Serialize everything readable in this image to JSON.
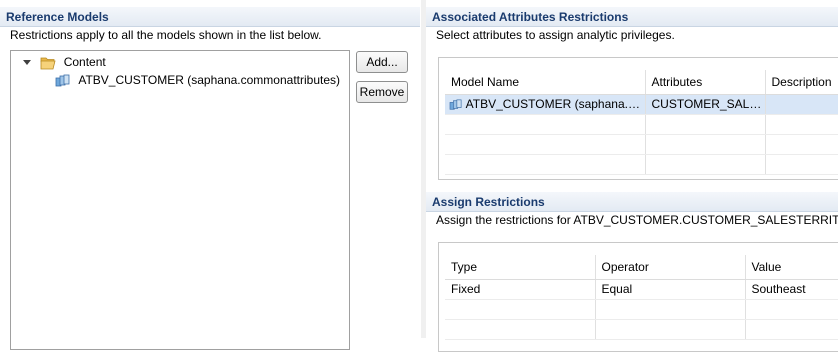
{
  "reference_models": {
    "title": "Reference Models",
    "description": "Restrictions apply to all the models shown in the list below.",
    "tree": {
      "root_label": "Content",
      "child_label": "ATBV_CUSTOMER (saphana.commonattributes)"
    },
    "add_label": "Add...",
    "remove_label": "Remove"
  },
  "associated_attributes": {
    "title": "Associated Attributes Restrictions",
    "description": "Select attributes to assign analytic privileges.",
    "columns": [
      "Model Name",
      "Attributes",
      "Description"
    ],
    "rows": [
      {
        "model": "ATBV_CUSTOMER (saphana.co...",
        "attributes": "CUSTOMER_SALE...",
        "description": ""
      }
    ]
  },
  "assign_restrictions": {
    "title": "Assign Restrictions",
    "description": "Assign the restrictions for ATBV_CUSTOMER.CUSTOMER_SALESTERRITORYR",
    "columns": [
      "Type",
      "Operator",
      "Value"
    ],
    "rows": [
      {
        "type": "Fixed",
        "operator": "Equal",
        "value": "Southeast"
      }
    ]
  }
}
